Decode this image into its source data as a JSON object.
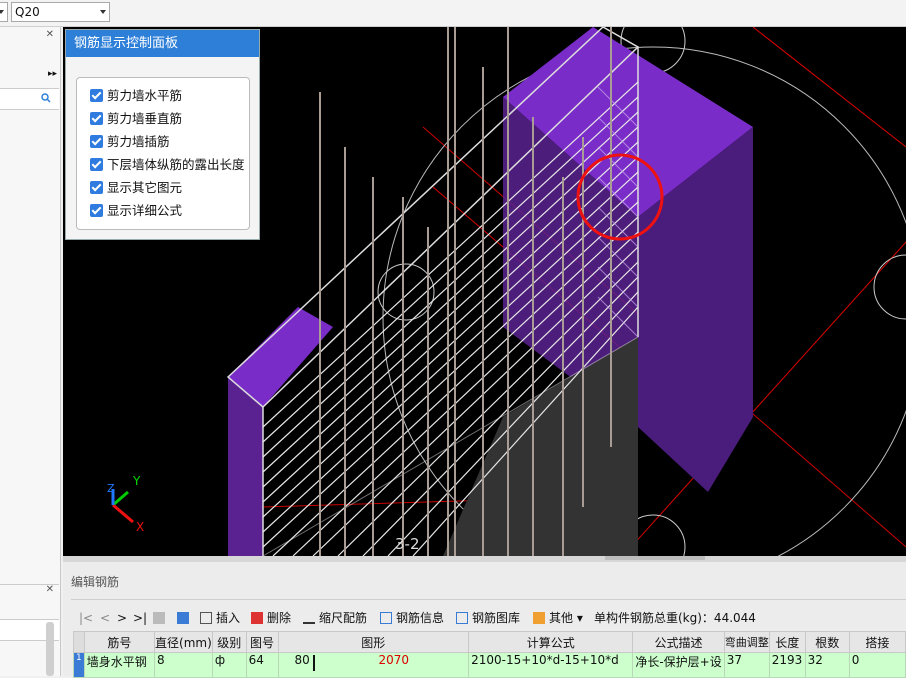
{
  "topbar": {
    "combo_value": "Q20"
  },
  "control_panel": {
    "title": "钢筋显示控制面板",
    "options": [
      {
        "label": "剪力墙水平筋",
        "checked": true
      },
      {
        "label": "剪力墙垂直筋",
        "checked": true
      },
      {
        "label": "剪力墙插筋",
        "checked": true
      },
      {
        "label": "下层墙体纵筋的露出长度",
        "checked": true
      },
      {
        "label": "显示其它图元",
        "checked": true
      },
      {
        "label": "显示详细公式",
        "checked": true
      }
    ]
  },
  "viewport": {
    "label": "3-2",
    "axes": {
      "x": "X",
      "y": "Y",
      "z": "Z"
    }
  },
  "bottom_panel": {
    "title": "编辑钢筋"
  },
  "toolbar": {
    "nav": [
      "|<",
      "<",
      ">",
      ">|"
    ],
    "insert": "插入",
    "delete": "删除",
    "scale": "缩尺配筋",
    "info": "钢筋信息",
    "library": "钢筋图库",
    "other": "其他",
    "total_label": "单构件钢筋总重(kg)：44.044"
  },
  "table": {
    "headers": [
      "筋号",
      "直径(mm)",
      "级别",
      "图号",
      "图形",
      "计算公式",
      "公式描述",
      "弯曲调整",
      "长度",
      "根数",
      "搭接"
    ],
    "rows": [
      {
        "index": "1",
        "name": "墙身水平钢",
        "diameter": "8",
        "grade": "ф",
        "figure_no": "64",
        "shape_left": "80",
        "shape_mid": "2070",
        "shape_right": "80",
        "formula": "2100-15+10*d-15+10*d",
        "desc": "净长-保护层+设",
        "bend": "37",
        "length": "2193",
        "count": "32",
        "lap": "0"
      }
    ]
  },
  "colors": {
    "accent": "#2e7fd8",
    "wall": "#6a1fb0",
    "row_bg": "#ccffcc"
  }
}
